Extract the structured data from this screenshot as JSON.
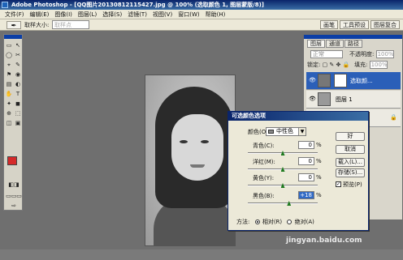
{
  "titlebar": {
    "app": "Adobe Photoshop",
    "doc": "- [QQ图片20130812115427.jpg @ 100% (选取颜色 1, 图层蒙版/8)]"
  },
  "menubar": [
    "文件(F)",
    "编辑(E)",
    "图像(I)",
    "图层(L)",
    "选择(S)",
    "滤镜(T)",
    "视图(V)",
    "窗口(W)",
    "帮助(H)"
  ],
  "optionsbar": {
    "tool_glyph": "✒",
    "size_label": "取样大小:",
    "size_value": "取样点",
    "sample_label": "",
    "sample_value": "",
    "well_tabs": [
      "画笔",
      "工具预设",
      "图层复合"
    ]
  },
  "toolbox": {
    "tools": [
      "▭",
      "↖",
      "◯",
      "✂",
      "⌖",
      "✎",
      "⚑",
      "◉",
      "▤",
      "◐",
      "✋",
      "T",
      "✦",
      "◼",
      "⊕",
      "⬚",
      "◫",
      "▣"
    ],
    "foreground_color": "#d52a2a",
    "background_color": "#ffffff"
  },
  "layers": {
    "tabs": [
      "图层",
      "通道",
      "路径"
    ],
    "blend_mode": "正常",
    "opacity_label": "不透明度:",
    "opacity_value": "100%",
    "lock_label": "锁定:",
    "fill_label": "填充:",
    "fill_value": "100%",
    "items": [
      {
        "name": "选取颜...",
        "selected": true,
        "visible": "👁"
      },
      {
        "name": "图层 1",
        "selected": false,
        "visible": "👁"
      },
      {
        "name": "背景",
        "selected": false,
        "visible": "👁",
        "locked": "🔒"
      }
    ]
  },
  "dialog": {
    "title": "可选颜色选项",
    "color_label": "颜色(O):",
    "color_value": "中性色",
    "rows": [
      {
        "label": "青色(C):",
        "value": "0",
        "pct": "%",
        "slider": 0.5
      },
      {
        "label": "洋红(M):",
        "value": "0",
        "pct": "%",
        "slider": 0.5
      },
      {
        "label": "黄色(Y):",
        "value": "0",
        "pct": "%",
        "slider": 0.5
      },
      {
        "label": "黑色(B):",
        "value": "+18",
        "pct": "%",
        "slider": 0.59
      }
    ],
    "buttons": [
      "好",
      "取消",
      "载入(L)...",
      "存储(S)..."
    ],
    "preview_label": "预览(P)",
    "method_label": "方法:",
    "method_relative": "相对(R)",
    "method_absolute": "绝对(A)"
  },
  "watermark": "jingyan.baidu.com"
}
